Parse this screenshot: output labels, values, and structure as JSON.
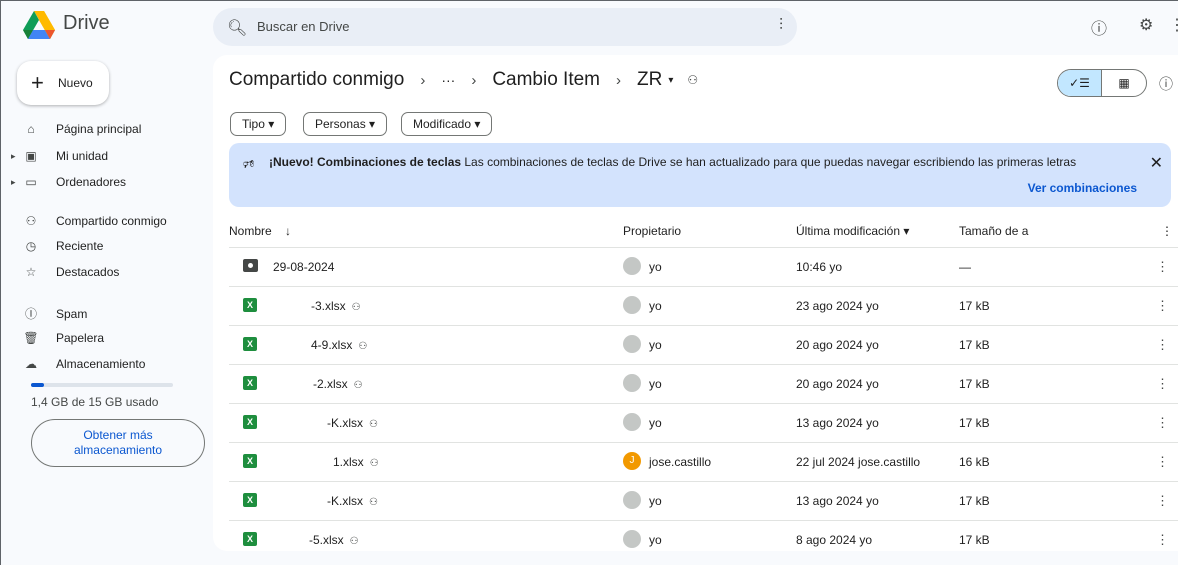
{
  "header": {
    "brand": "Drive",
    "search_placeholder": "Buscar en Drive"
  },
  "sidebar": {
    "new_label": "Nuevo",
    "items": [
      {
        "label": "Página principal"
      },
      {
        "label": "Mi unidad"
      },
      {
        "label": "Ordenadores"
      },
      {
        "label": "Compartido conmigo"
      },
      {
        "label": "Reciente"
      },
      {
        "label": "Destacados"
      },
      {
        "label": "Spam"
      },
      {
        "label": "Papelera"
      },
      {
        "label": "Almacenamiento"
      }
    ],
    "storage_text": "1,4 GB de 15 GB usado",
    "storage_fraction": 0.093,
    "get_more_line1": "Obtener más",
    "get_more_line2": "almacenamiento"
  },
  "breadcrumb": {
    "root": "Compartido conmigo",
    "ellipsis": "···",
    "mid": "Cambio Item",
    "current": "ZR"
  },
  "filters": [
    "Tipo",
    "Personas",
    "Modificado"
  ],
  "banner": {
    "bold": "¡Nuevo! Combinaciones de teclas",
    "text": " Las combinaciones de teclas de Drive se han actualizado para que puedas navegar escribiendo las primeras letras",
    "link": "Ver combinaciones"
  },
  "table": {
    "headers": {
      "name": "Nombre",
      "owner": "Propietario",
      "modified": "Última modificación",
      "size": "Tamaño de a"
    },
    "rows": [
      {
        "name": "29-08-2024",
        "owner": "yo",
        "modified": "10:46 yo",
        "size": "—"
      },
      {
        "name": "-3.xlsx",
        "owner": "yo",
        "modified": "23 ago 2024 yo",
        "size": "17 kB"
      },
      {
        "name": "4-9.xlsx",
        "owner": "yo",
        "modified": "20 ago 2024 yo",
        "size": "17 kB"
      },
      {
        "name": "-2.xlsx",
        "owner": "yo",
        "modified": "20 ago 2024 yo",
        "size": "17 kB"
      },
      {
        "name": "-K.xlsx",
        "owner": "yo",
        "modified": "13 ago 2024 yo",
        "size": "17 kB"
      },
      {
        "name": "1.xlsx",
        "owner": "jose.castillo",
        "modified": "22 jul 2024 jose.castillo",
        "size": "16 kB"
      },
      {
        "name": "-K.xlsx",
        "owner": "yo",
        "modified": "13 ago 2024 yo",
        "size": "17 kB"
      },
      {
        "name": "-5.xlsx",
        "owner": "yo",
        "modified": "8 ago 2024 yo",
        "size": "17 kB"
      }
    ]
  }
}
